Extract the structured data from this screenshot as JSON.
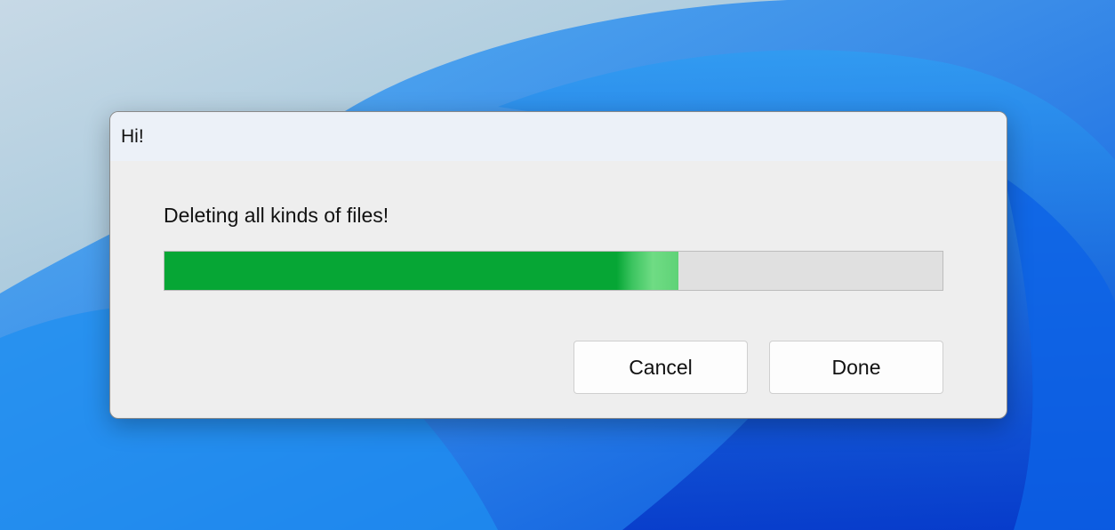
{
  "dialog": {
    "title": "Hi!",
    "message": "Deleting all kinds of files!",
    "progress_fraction": 0.66,
    "buttons": {
      "cancel_label": "Cancel",
      "done_label": "Done"
    }
  },
  "colors": {
    "progress_fill": "#06a635",
    "progress_track": "#e0e0e0",
    "dialog_bg": "#eeeeee",
    "titlebar_bg": "#ecf1f8"
  }
}
